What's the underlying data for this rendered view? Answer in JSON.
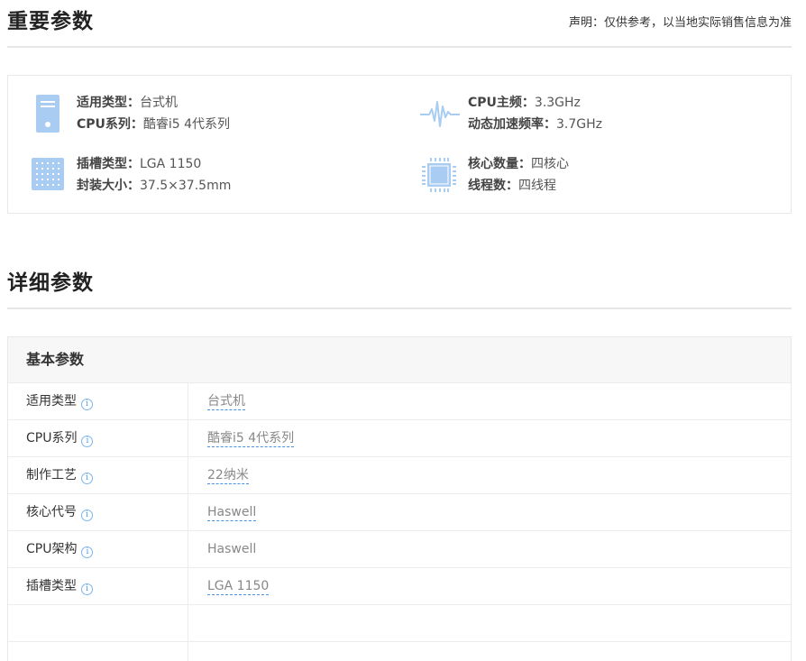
{
  "important": {
    "title": "重要参数",
    "disclaimer": "声明：仅供参考，以当地实际销售信息为准",
    "items": [
      {
        "icon": "desktop-tower-icon",
        "lines": [
          {
            "k": "适用类型：",
            "v": "台式机"
          },
          {
            "k": "CPU系列：",
            "v": "酷睿i5 4代系列"
          }
        ]
      },
      {
        "icon": "frequency-wave-icon",
        "lines": [
          {
            "k": "CPU主频：",
            "v": "3.3GHz"
          },
          {
            "k": "动态加速频率：",
            "v": "3.7GHz"
          }
        ]
      },
      {
        "icon": "socket-grid-icon",
        "lines": [
          {
            "k": "插槽类型：",
            "v": "LGA 1150"
          },
          {
            "k": "封装大小：",
            "v": "37.5×37.5mm"
          }
        ]
      },
      {
        "icon": "cpu-chip-icon",
        "lines": [
          {
            "k": "核心数量：",
            "v": "四核心"
          },
          {
            "k": "线程数：",
            "v": "四线程"
          }
        ]
      }
    ]
  },
  "detail": {
    "title": "详细参数",
    "group_title": "基本参数",
    "rows": [
      {
        "k": "适用类型",
        "v": "台式机",
        "link": true
      },
      {
        "k": "CPU系列",
        "v": "酷睿i5 4代系列",
        "link": true
      },
      {
        "k": "制作工艺",
        "v": "22纳米",
        "link": true
      },
      {
        "k": "核心代号",
        "v": "Haswell",
        "link": true
      },
      {
        "k": "CPU架构",
        "v": "Haswell",
        "link": false
      },
      {
        "k": "插槽类型",
        "v": "LGA 1150",
        "link": true
      },
      {
        "k": "",
        "v": "",
        "link": false
      },
      {
        "k": "",
        "v": "",
        "link": false
      }
    ],
    "info_glyph": "i"
  },
  "colors": {
    "icon_blue": "#a9cdf2",
    "link_blue": "#4a90e2"
  }
}
